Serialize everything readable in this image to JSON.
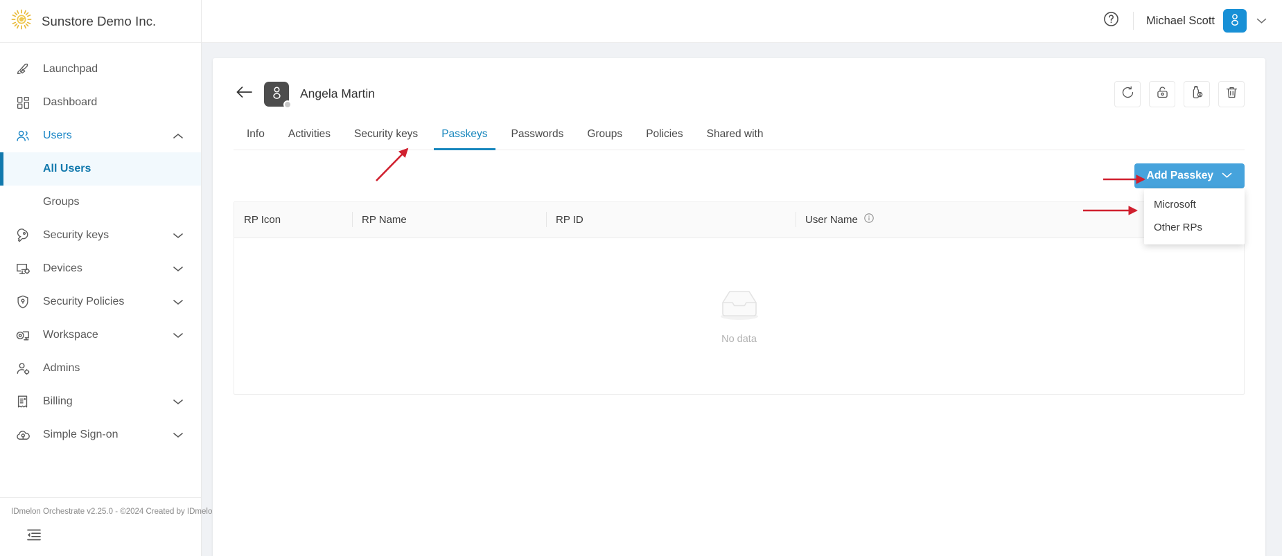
{
  "brand": {
    "title": "Sunstore Demo Inc.",
    "logo_icon": "sun-icon"
  },
  "sidebar": {
    "items": [
      {
        "label": "Launchpad",
        "icon": "rocket-icon",
        "expandable": false
      },
      {
        "label": "Dashboard",
        "icon": "grid-icon",
        "expandable": false
      },
      {
        "label": "Users",
        "icon": "users-icon",
        "expandable": true,
        "expanded": true
      },
      {
        "label": "Security keys",
        "icon": "key-icon",
        "expandable": true
      },
      {
        "label": "Devices",
        "icon": "device-icon",
        "expandable": true
      },
      {
        "label": "Security Policies",
        "icon": "shield-icon",
        "expandable": true
      },
      {
        "label": "Workspace",
        "icon": "workspace-icon",
        "expandable": true
      },
      {
        "label": "Admins",
        "icon": "admin-icon",
        "expandable": false
      },
      {
        "label": "Billing",
        "icon": "billing-icon",
        "expandable": true
      },
      {
        "label": "Simple Sign-on",
        "icon": "cloud-key-icon",
        "expandable": true
      }
    ],
    "users_children": [
      {
        "label": "All Users",
        "active": true
      },
      {
        "label": "Groups",
        "active": false
      }
    ],
    "footer_text": "IDmelon Orchestrate v2.25.0 - ©2024 Created by IDmelon",
    "collapse_icon": "collapse-sidebar-icon"
  },
  "topbar": {
    "help_icon": "help-circle-icon",
    "user_name": "Michael Scott",
    "avatar_icon": "person-icon",
    "caret_icon": "chevron-down-icon"
  },
  "detail": {
    "back_icon": "arrow-left-icon",
    "avatar_icon": "person-icon",
    "name": "Angela Martin",
    "actions": [
      {
        "name": "reset-button",
        "icon": "refresh-ccw-icon"
      },
      {
        "name": "unlock-button",
        "icon": "unlock-icon"
      },
      {
        "name": "revoke-key-button",
        "icon": "usb-key-remove-icon"
      },
      {
        "name": "delete-button",
        "icon": "trash-icon"
      }
    ],
    "tabs": [
      {
        "label": "Info",
        "active": false
      },
      {
        "label": "Activities",
        "active": false
      },
      {
        "label": "Security keys",
        "active": false
      },
      {
        "label": "Passkeys",
        "active": true
      },
      {
        "label": "Passwords",
        "active": false
      },
      {
        "label": "Groups",
        "active": false
      },
      {
        "label": "Policies",
        "active": false
      },
      {
        "label": "Shared with",
        "active": false
      }
    ],
    "add_button": {
      "label": "Add Passkey",
      "caret_icon": "chevron-down-icon"
    },
    "dropdown": {
      "open": true,
      "options": [
        {
          "label": "Microsoft"
        },
        {
          "label": "Other RPs"
        }
      ]
    },
    "table": {
      "columns": [
        {
          "label": "RP Icon",
          "info": false
        },
        {
          "label": "RP Name",
          "info": false
        },
        {
          "label": "RP ID",
          "info": false
        },
        {
          "label": "User Name",
          "info": true,
          "info_icon": "info-circle-icon"
        }
      ],
      "rows": [],
      "empty_text": "No data",
      "empty_icon": "empty-tray-icon"
    }
  },
  "annotations": {
    "arrow_color": "#d0202f",
    "arrows": [
      {
        "name": "arrow-to-passkeys-tab",
        "target": "Passkeys tab"
      },
      {
        "name": "arrow-to-add-passkey-button",
        "target": "Add Passkey button"
      },
      {
        "name": "arrow-to-dropdown-menu",
        "target": "Microsoft dropdown option"
      }
    ]
  },
  "colors": {
    "accent": "#1786bd",
    "button": "#46a3dc",
    "brand_logo": "#e8b93a",
    "avatar_blue": "#1890d6",
    "annotation_red": "#d0202f"
  }
}
